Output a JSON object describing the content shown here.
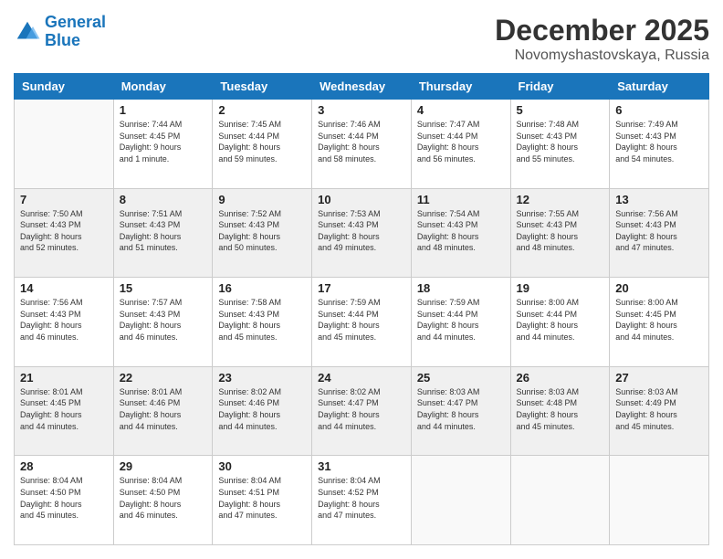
{
  "header": {
    "logo_line1": "General",
    "logo_line2": "Blue",
    "month": "December 2025",
    "location": "Novomyshastovskaya, Russia"
  },
  "weekdays": [
    "Sunday",
    "Monday",
    "Tuesday",
    "Wednesday",
    "Thursday",
    "Friday",
    "Saturday"
  ],
  "weeks": [
    [
      {
        "day": "",
        "info": ""
      },
      {
        "day": "1",
        "info": "Sunrise: 7:44 AM\nSunset: 4:45 PM\nDaylight: 9 hours\nand 1 minute."
      },
      {
        "day": "2",
        "info": "Sunrise: 7:45 AM\nSunset: 4:44 PM\nDaylight: 8 hours\nand 59 minutes."
      },
      {
        "day": "3",
        "info": "Sunrise: 7:46 AM\nSunset: 4:44 PM\nDaylight: 8 hours\nand 58 minutes."
      },
      {
        "day": "4",
        "info": "Sunrise: 7:47 AM\nSunset: 4:44 PM\nDaylight: 8 hours\nand 56 minutes."
      },
      {
        "day": "5",
        "info": "Sunrise: 7:48 AM\nSunset: 4:43 PM\nDaylight: 8 hours\nand 55 minutes."
      },
      {
        "day": "6",
        "info": "Sunrise: 7:49 AM\nSunset: 4:43 PM\nDaylight: 8 hours\nand 54 minutes."
      }
    ],
    [
      {
        "day": "7",
        "info": "Sunrise: 7:50 AM\nSunset: 4:43 PM\nDaylight: 8 hours\nand 52 minutes."
      },
      {
        "day": "8",
        "info": "Sunrise: 7:51 AM\nSunset: 4:43 PM\nDaylight: 8 hours\nand 51 minutes."
      },
      {
        "day": "9",
        "info": "Sunrise: 7:52 AM\nSunset: 4:43 PM\nDaylight: 8 hours\nand 50 minutes."
      },
      {
        "day": "10",
        "info": "Sunrise: 7:53 AM\nSunset: 4:43 PM\nDaylight: 8 hours\nand 49 minutes."
      },
      {
        "day": "11",
        "info": "Sunrise: 7:54 AM\nSunset: 4:43 PM\nDaylight: 8 hours\nand 48 minutes."
      },
      {
        "day": "12",
        "info": "Sunrise: 7:55 AM\nSunset: 4:43 PM\nDaylight: 8 hours\nand 48 minutes."
      },
      {
        "day": "13",
        "info": "Sunrise: 7:56 AM\nSunset: 4:43 PM\nDaylight: 8 hours\nand 47 minutes."
      }
    ],
    [
      {
        "day": "14",
        "info": "Sunrise: 7:56 AM\nSunset: 4:43 PM\nDaylight: 8 hours\nand 46 minutes."
      },
      {
        "day": "15",
        "info": "Sunrise: 7:57 AM\nSunset: 4:43 PM\nDaylight: 8 hours\nand 46 minutes."
      },
      {
        "day": "16",
        "info": "Sunrise: 7:58 AM\nSunset: 4:43 PM\nDaylight: 8 hours\nand 45 minutes."
      },
      {
        "day": "17",
        "info": "Sunrise: 7:59 AM\nSunset: 4:44 PM\nDaylight: 8 hours\nand 45 minutes."
      },
      {
        "day": "18",
        "info": "Sunrise: 7:59 AM\nSunset: 4:44 PM\nDaylight: 8 hours\nand 44 minutes."
      },
      {
        "day": "19",
        "info": "Sunrise: 8:00 AM\nSunset: 4:44 PM\nDaylight: 8 hours\nand 44 minutes."
      },
      {
        "day": "20",
        "info": "Sunrise: 8:00 AM\nSunset: 4:45 PM\nDaylight: 8 hours\nand 44 minutes."
      }
    ],
    [
      {
        "day": "21",
        "info": "Sunrise: 8:01 AM\nSunset: 4:45 PM\nDaylight: 8 hours\nand 44 minutes."
      },
      {
        "day": "22",
        "info": "Sunrise: 8:01 AM\nSunset: 4:46 PM\nDaylight: 8 hours\nand 44 minutes."
      },
      {
        "day": "23",
        "info": "Sunrise: 8:02 AM\nSunset: 4:46 PM\nDaylight: 8 hours\nand 44 minutes."
      },
      {
        "day": "24",
        "info": "Sunrise: 8:02 AM\nSunset: 4:47 PM\nDaylight: 8 hours\nand 44 minutes."
      },
      {
        "day": "25",
        "info": "Sunrise: 8:03 AM\nSunset: 4:47 PM\nDaylight: 8 hours\nand 44 minutes."
      },
      {
        "day": "26",
        "info": "Sunrise: 8:03 AM\nSunset: 4:48 PM\nDaylight: 8 hours\nand 45 minutes."
      },
      {
        "day": "27",
        "info": "Sunrise: 8:03 AM\nSunset: 4:49 PM\nDaylight: 8 hours\nand 45 minutes."
      }
    ],
    [
      {
        "day": "28",
        "info": "Sunrise: 8:04 AM\nSunset: 4:50 PM\nDaylight: 8 hours\nand 45 minutes."
      },
      {
        "day": "29",
        "info": "Sunrise: 8:04 AM\nSunset: 4:50 PM\nDaylight: 8 hours\nand 46 minutes."
      },
      {
        "day": "30",
        "info": "Sunrise: 8:04 AM\nSunset: 4:51 PM\nDaylight: 8 hours\nand 47 minutes."
      },
      {
        "day": "31",
        "info": "Sunrise: 8:04 AM\nSunset: 4:52 PM\nDaylight: 8 hours\nand 47 minutes."
      },
      {
        "day": "",
        "info": ""
      },
      {
        "day": "",
        "info": ""
      },
      {
        "day": "",
        "info": ""
      }
    ]
  ]
}
